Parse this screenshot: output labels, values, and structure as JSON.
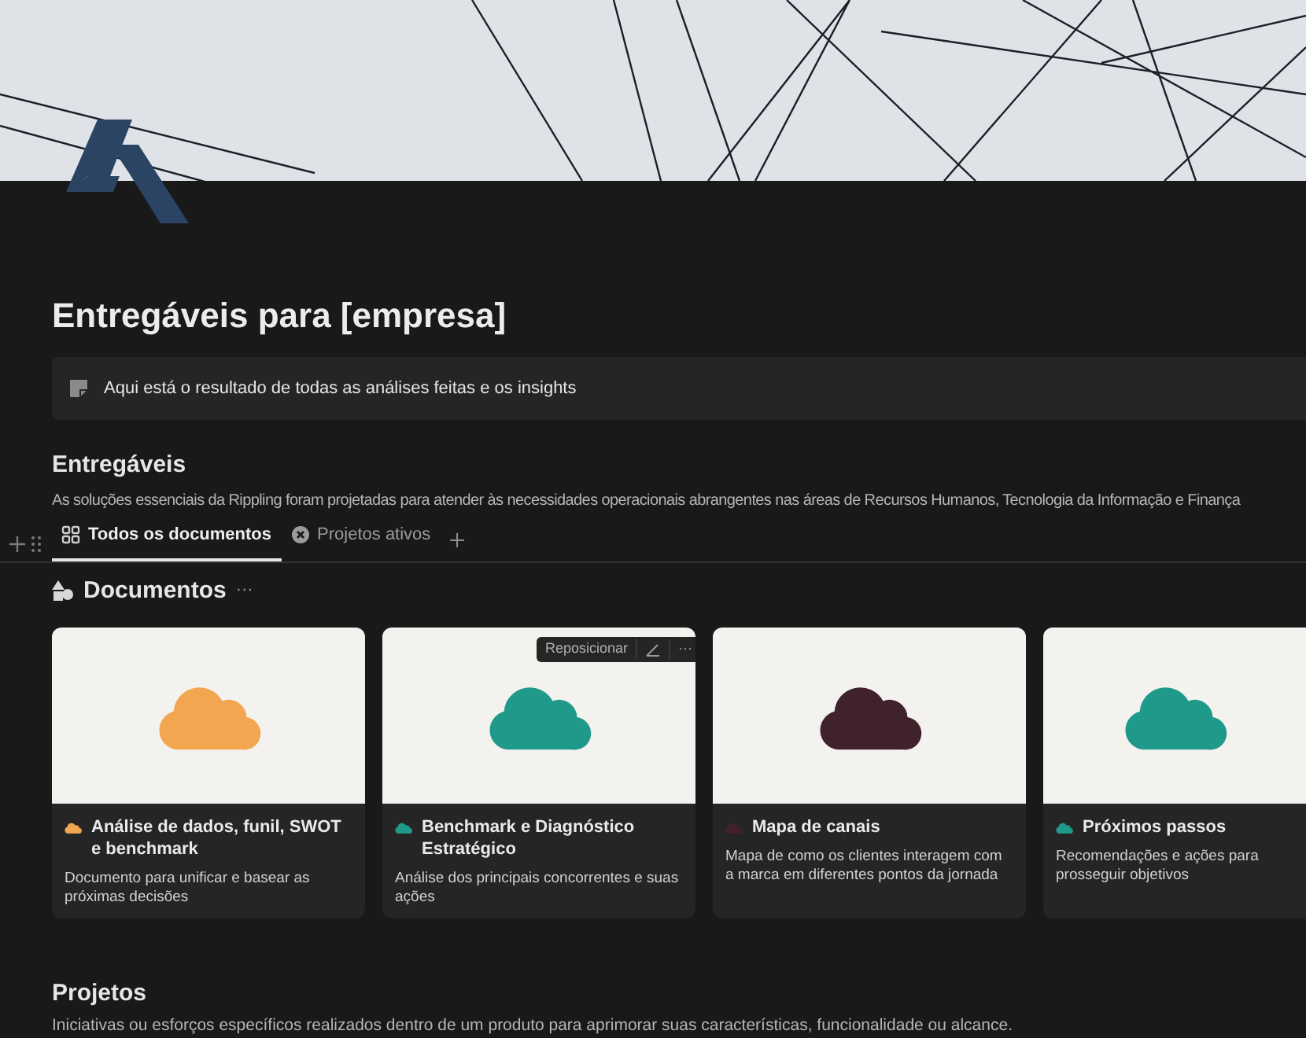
{
  "title": "Entregáveis para [empresa]",
  "callout": {
    "text": "Aqui está o resultado de todas as análises feitas e os insights"
  },
  "sections": [
    {
      "heading": "Entregáveis",
      "description": "As soluções essenciais da Rippling foram projetadas para atender às necessidades operacionais abrangentes nas áreas de Recursos Humanos, Tecnologia da Informação e Finança"
    }
  ],
  "tabs": [
    {
      "label": "Todos os documentos",
      "kind": "grid",
      "selected": true
    },
    {
      "label": "Projetos ativos",
      "kind": "status",
      "selected": false
    }
  ],
  "gallery": {
    "title": "Documentos",
    "more": "···"
  },
  "cards": [
    {
      "title": "Análise de dados, funil, SWOT e benchmark",
      "description": "Documento para unificar e basear as próximas decisões",
      "color": "#f2a64f"
    },
    {
      "title": "Benchmark e Diagnóstico Estratégico",
      "description": "Análise dos principais concorrentes e suas ações",
      "color": "#1f9a8a",
      "toolbar": {
        "label": "Reposicionar",
        "more": "···"
      }
    },
    {
      "title": "Mapa de canais",
      "description": "Mapa de como os clientes interagem com a marca em diferentes pontos da jornada",
      "color": "#40222c"
    },
    {
      "title": "Próximos passos",
      "description": "Recomendações e ações para prosseguir objetivos",
      "color": "#1f9a8a"
    }
  ],
  "projects": {
    "heading": "Projetos",
    "description": "Iniciativas ou esforços específicos realizados dentro de um produto para aprimorar suas características, funcionalidade ou alcance."
  }
}
